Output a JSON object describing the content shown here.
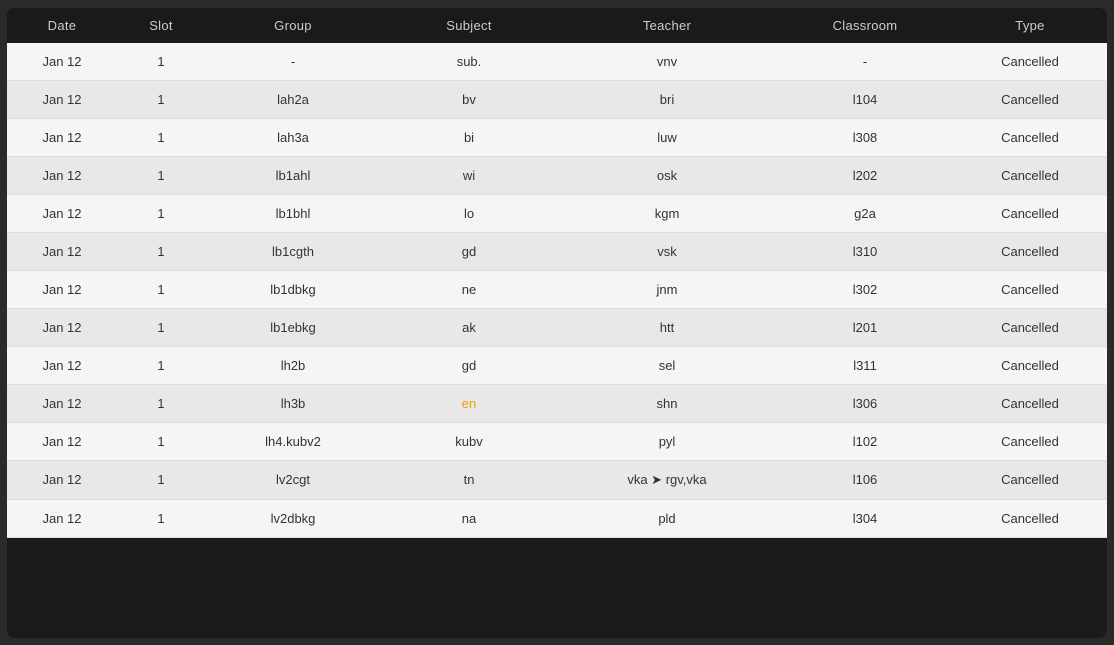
{
  "table": {
    "headers": {
      "date": "Date",
      "slot": "Slot",
      "group": "Group",
      "subject": "Subject",
      "teacher": "Teacher",
      "classroom": "Classroom",
      "type": "Type"
    },
    "rows": [
      {
        "date": "Jan 12",
        "slot": "1",
        "group": "-",
        "subject": "sub.",
        "teacher": "vnv",
        "classroom": "-",
        "type": "Cancelled",
        "subject_highlight": false
      },
      {
        "date": "Jan 12",
        "slot": "1",
        "group": "lah2a",
        "subject": "bv",
        "teacher": "bri",
        "classroom": "l104",
        "type": "Cancelled",
        "subject_highlight": false
      },
      {
        "date": "Jan 12",
        "slot": "1",
        "group": "lah3a",
        "subject": "bi",
        "teacher": "luw",
        "classroom": "l308",
        "type": "Cancelled",
        "subject_highlight": false
      },
      {
        "date": "Jan 12",
        "slot": "1",
        "group": "lb1ahl",
        "subject": "wi",
        "teacher": "osk",
        "classroom": "l202",
        "type": "Cancelled",
        "subject_highlight": false
      },
      {
        "date": "Jan 12",
        "slot": "1",
        "group": "lb1bhl",
        "subject": "lo",
        "teacher": "kgm",
        "classroom": "g2a",
        "type": "Cancelled",
        "subject_highlight": false
      },
      {
        "date": "Jan 12",
        "slot": "1",
        "group": "lb1cgth",
        "subject": "gd",
        "teacher": "vsk",
        "classroom": "l310",
        "type": "Cancelled",
        "subject_highlight": false
      },
      {
        "date": "Jan 12",
        "slot": "1",
        "group": "lb1dbkg",
        "subject": "ne",
        "teacher": "jnm",
        "classroom": "l302",
        "type": "Cancelled",
        "subject_highlight": false
      },
      {
        "date": "Jan 12",
        "slot": "1",
        "group": "lb1ebkg",
        "subject": "ak",
        "teacher": "htt",
        "classroom": "l201",
        "type": "Cancelled",
        "subject_highlight": false
      },
      {
        "date": "Jan 12",
        "slot": "1",
        "group": "lh2b",
        "subject": "gd",
        "teacher": "sel",
        "classroom": "l311",
        "type": "Cancelled",
        "subject_highlight": false
      },
      {
        "date": "Jan 12",
        "slot": "1",
        "group": "lh3b",
        "subject": "en",
        "teacher": "shn",
        "classroom": "l306",
        "type": "Cancelled",
        "subject_highlight": true
      },
      {
        "date": "Jan 12",
        "slot": "1",
        "group": "lh4.kubv2",
        "subject": "kubv",
        "teacher": "pyl",
        "classroom": "l102",
        "type": "Cancelled",
        "subject_highlight": false
      },
      {
        "date": "Jan 12",
        "slot": "1",
        "group": "lv2cgt",
        "subject": "tn",
        "teacher": "vka ➤ rgv,vka",
        "classroom": "l106",
        "type": "Cancelled",
        "subject_highlight": false
      },
      {
        "date": "Jan 12",
        "slot": "1",
        "group": "lv2dbkg",
        "subject": "na",
        "teacher": "pld",
        "classroom": "l304",
        "type": "Cancelled",
        "subject_highlight": false
      }
    ]
  }
}
